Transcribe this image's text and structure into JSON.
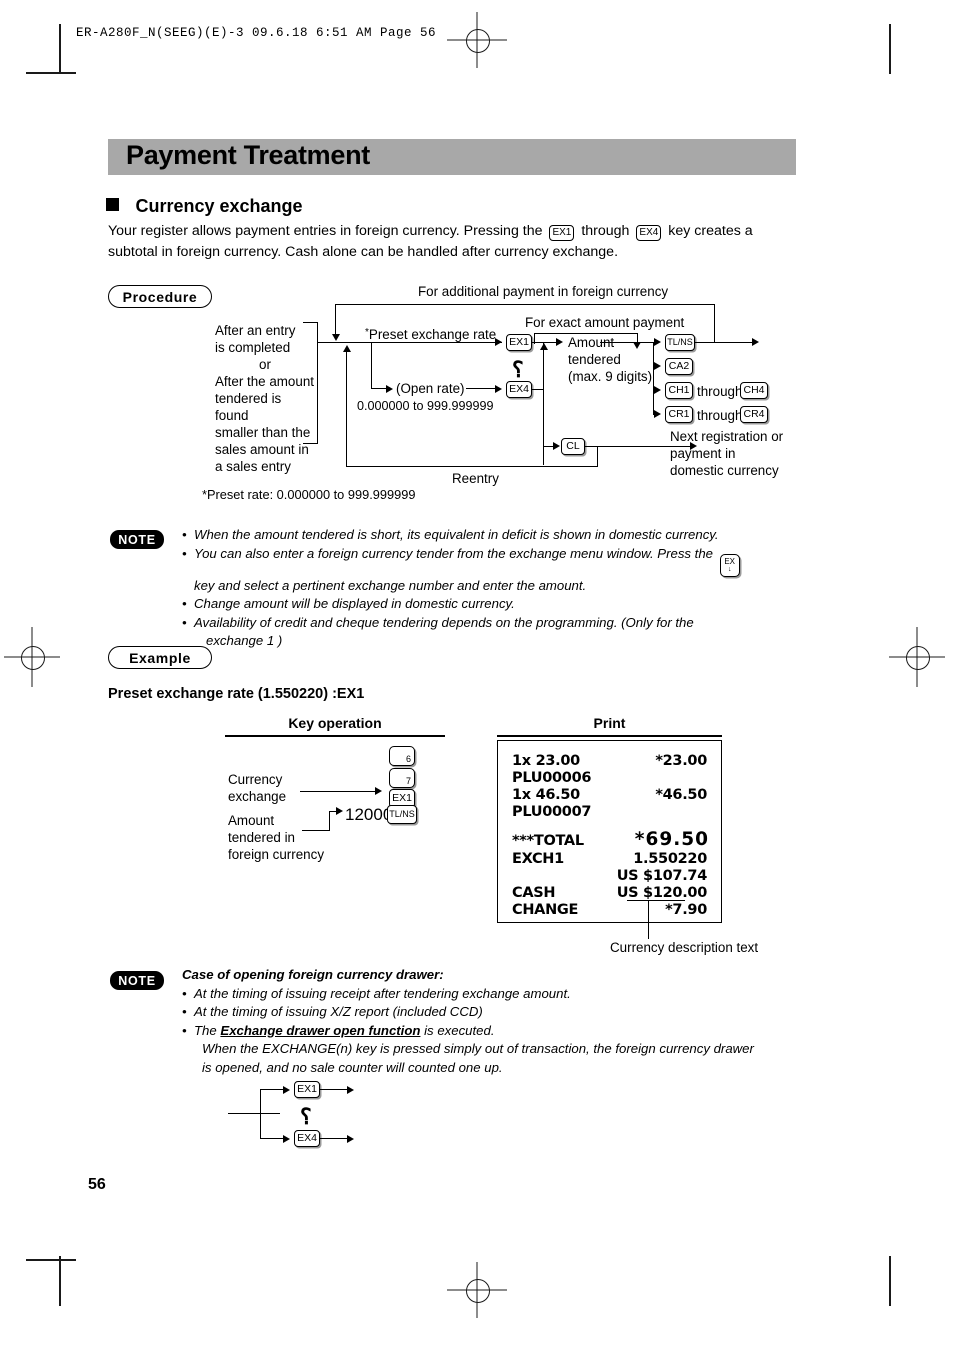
{
  "page": {
    "printer_header": "ER-A280F_N(SEEG)(E)-3   09.6.18 6:51 AM   Page 56",
    "page_number": "56"
  },
  "title": "Payment Treatment",
  "section": {
    "heading": "Currency exchange",
    "intro_part1": "Your register allows payment entries in foreign currency.  Pressing the",
    "intro_key1": "EX1",
    "intro_part2": "through",
    "intro_key2": "EX4",
    "intro_part3": "key creates a",
    "intro_line2": "subtotal in foreign currency. Cash alone can be handled after currency exchange."
  },
  "procedure": {
    "pill_label": "Procedure",
    "top_label": "For additional payment in foreign currency",
    "exact_label": "For exact amount payment",
    "left_text_lines": [
      "After an entry",
      "is completed",
      "or",
      "After the amount",
      "tendered is found",
      "smaller than the",
      "sales amount in",
      "a sales entry"
    ],
    "preset_rate_label": "Preset exchange rate",
    "preset_asterisk": "*",
    "open_rate_label": "(Open rate)",
    "open_rate_range": "0.000000 to 999.999999",
    "key_ex1": "EX1",
    "key_ex4": "EX4",
    "squiggle": "⸮",
    "amount_lines": [
      "Amount",
      "tendered",
      "(max. 9 digits)"
    ],
    "key_tlns": "TL/NS",
    "key_ca2": "CA2",
    "key_ch1": "CH1",
    "through1": "through",
    "key_ch4": "CH4",
    "key_cr1": "CR1",
    "through2": "through",
    "key_cr4": "CR4",
    "key_cl": "CL",
    "next_lines": [
      "Next registration or",
      "payment in",
      "domestic currency"
    ],
    "reentry_label": "Reentry",
    "footnote": "*Preset rate: 0.000000 to 999.999999"
  },
  "note_top": {
    "badge": "NOTE",
    "items": [
      "When the amount tendered is short, its equivalent in deficit is shown in domestic currency.",
      "You can also enter a foreign currency tender from the exchange menu window. Press the",
      "key and select a pertinent exchange number and enter the amount.",
      "Change amount will be displayed in domestic currency.",
      "Availability of credit and cheque tendering depends on the programming. (Only for the",
      "exchange 1 )"
    ],
    "inline_key_top": "EX",
    "inline_key_bottom": "↓"
  },
  "example": {
    "pill_label": "Example",
    "subtitle": "Preset exchange rate (1.550220) :EX1",
    "col_key_operation": "Key operation",
    "col_print": "Print",
    "label_currency_exchange": [
      "Currency",
      "exchange"
    ],
    "label_amount_tendered": [
      "Amount",
      "tendered in",
      "foreign currency"
    ],
    "keys": [
      "6",
      "7",
      "EX1",
      "TL/NS"
    ],
    "entry_value": "12000",
    "caption": "Currency description text"
  },
  "receipt": {
    "rows": [
      {
        "left": "1x 23.00",
        "right": "*23.00",
        "big": false
      },
      {
        "left": "PLU00006",
        "right": "",
        "big": false
      },
      {
        "left": "1x 46.50",
        "right": "*46.50",
        "big": false
      },
      {
        "left": "PLU00007",
        "right": "",
        "big": false
      },
      {
        "left": "",
        "right": "",
        "big": false
      },
      {
        "left": "***TOTAL",
        "right": "*69.50",
        "big": true
      },
      {
        "left": "EXCH1",
        "right": "1.550220",
        "big": false
      },
      {
        "left": "",
        "right": "US $107.74",
        "big": false
      },
      {
        "left": "CASH",
        "right": "US $120.00",
        "big": false
      },
      {
        "left": "CHANGE",
        "right": "*7.90",
        "big": false
      }
    ]
  },
  "note_bottom": {
    "badge": "NOTE",
    "title": "Case of opening foreign currency drawer:",
    "items": [
      "At the timing of issuing receipt after tendering exchange amount.",
      "At the timing of issuing X/Z report (included CCD)",
      "The",
      "Exchange drawer open function",
      "is executed.",
      "When the EXCHANGE(n) key is pressed simply out of transaction, the foreign currency drawer",
      "is opened, and no sale counter will counted one up."
    ]
  },
  "bottom_diagram": {
    "key_ex1": "EX1",
    "key_ex4": "EX4",
    "squiggle": "⸮"
  }
}
